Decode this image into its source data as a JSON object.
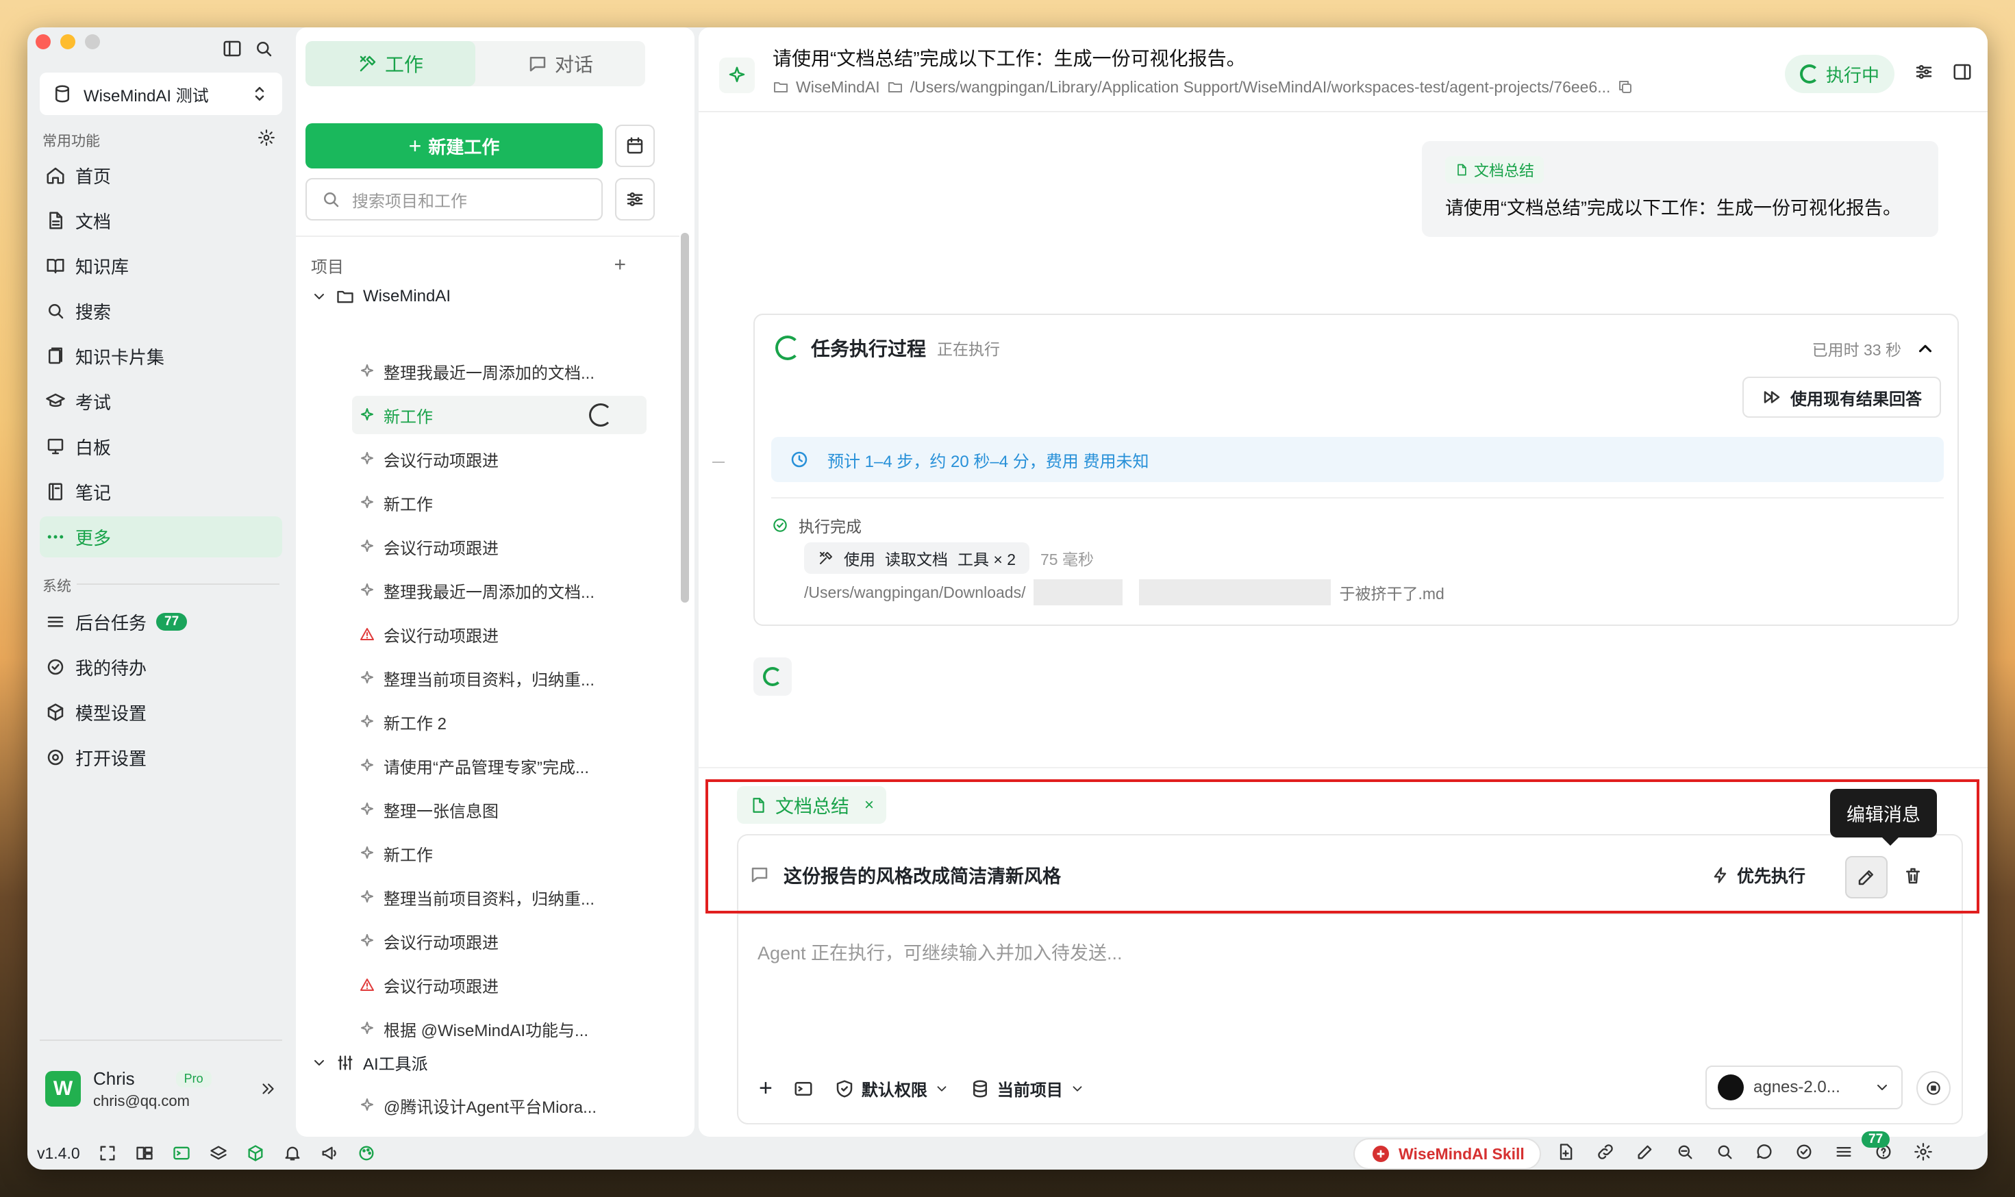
{
  "app": {
    "workspace": "WiseMindAI 测试",
    "version": "v1.4.0"
  },
  "sidebar": {
    "common_label": "常用功能",
    "items": [
      {
        "label": "首页",
        "icon": "home-icon"
      },
      {
        "label": "文档",
        "icon": "document-icon"
      },
      {
        "label": "知识库",
        "icon": "book-icon"
      },
      {
        "label": "搜索",
        "icon": "search-icon"
      },
      {
        "label": "知识卡片集",
        "icon": "cards-icon"
      },
      {
        "label": "考试",
        "icon": "graduation-icon"
      },
      {
        "label": "白板",
        "icon": "whiteboard-icon"
      },
      {
        "label": "笔记",
        "icon": "notebook-icon"
      },
      {
        "label": "更多",
        "icon": "more-icon"
      }
    ],
    "system_label": "系统",
    "system_items": [
      {
        "label": "后台任务",
        "icon": "list-icon",
        "badge": "77"
      },
      {
        "label": "我的待办",
        "icon": "check-circle-icon"
      },
      {
        "label": "模型设置",
        "icon": "cube-icon"
      },
      {
        "label": "打开设置",
        "icon": "gear-icon"
      }
    ],
    "user": {
      "name": "Chris",
      "email": "chris@qq.com",
      "plan": "Pro",
      "avatar_letter": "W"
    }
  },
  "projects": {
    "tab_work": "工作",
    "tab_chat": "对话",
    "new_work": "新建工作",
    "search_placeholder": "搜索项目和工作",
    "section_label": "项目",
    "folder1": "WiseMindAI",
    "items": [
      {
        "label": "整理我最近一周添加的文档..."
      },
      {
        "label": "新工作"
      },
      {
        "label": "会议行动项跟进"
      },
      {
        "label": "新工作"
      },
      {
        "label": "会议行动项跟进"
      },
      {
        "label": "整理我最近一周添加的文档..."
      },
      {
        "label": "会议行动项跟进"
      },
      {
        "label": "整理当前项目资料，归纳重..."
      },
      {
        "label": "新工作 2"
      },
      {
        "label": "请使用“产品管理专家”完成..."
      },
      {
        "label": "整理一张信息图"
      },
      {
        "label": "新工作"
      },
      {
        "label": "整理当前项目资料，归纳重..."
      },
      {
        "label": "会议行动项跟进"
      },
      {
        "label": "会议行动项跟进"
      },
      {
        "label": "根据 @WiseMindAI功能与..."
      }
    ],
    "folder2": "AI工具派",
    "folder2_item": "@腾讯设计Agent平台Miora..."
  },
  "header": {
    "title": "请使用“文档总结”完成以下工作：生成一份可视化报告。",
    "crumb1": "WiseMindAI",
    "path": "/Users/wangpingan/Library/Application Support/WiseMindAI/workspaces-test/agent-projects/76ee6...",
    "status": "执行中"
  },
  "message": {
    "tag": "文档总结",
    "text": "请使用“文档总结”完成以下工作：生成一份可视化报告。"
  },
  "task": {
    "title": "任务执行过程",
    "state": "正在执行",
    "elapsed": "已用时 33 秒",
    "use_result": "使用现有结果回答",
    "estimate": "预计 1–4 步，约 20 秒–4 分，费用 费用未知",
    "done": "执行完成",
    "tool_prefix": "使用",
    "tool_name": "读取文档",
    "tool_suffix": "工具 × 2",
    "tool_ms": "75 毫秒",
    "path_start": "/Users/wangpingan/Downloads/",
    "path_end": "于被挤干了.md"
  },
  "composer": {
    "skill_tag": "文档总结",
    "queued_text": "这份报告的风格改成简洁清新风格",
    "priority": "优先执行",
    "tooltip": "编辑消息",
    "placeholder": "Agent 正在执行，可继续输入并加入待发送...",
    "permission": "默认权限",
    "project": "当前项目",
    "model": "agnes-2.0..."
  },
  "bottom": {
    "skill": "WiseMindAI Skill",
    "badge": "77"
  },
  "colors": {
    "accent": "#1ab85c",
    "highlight": "#e11f1f",
    "info": "#2790d8"
  }
}
